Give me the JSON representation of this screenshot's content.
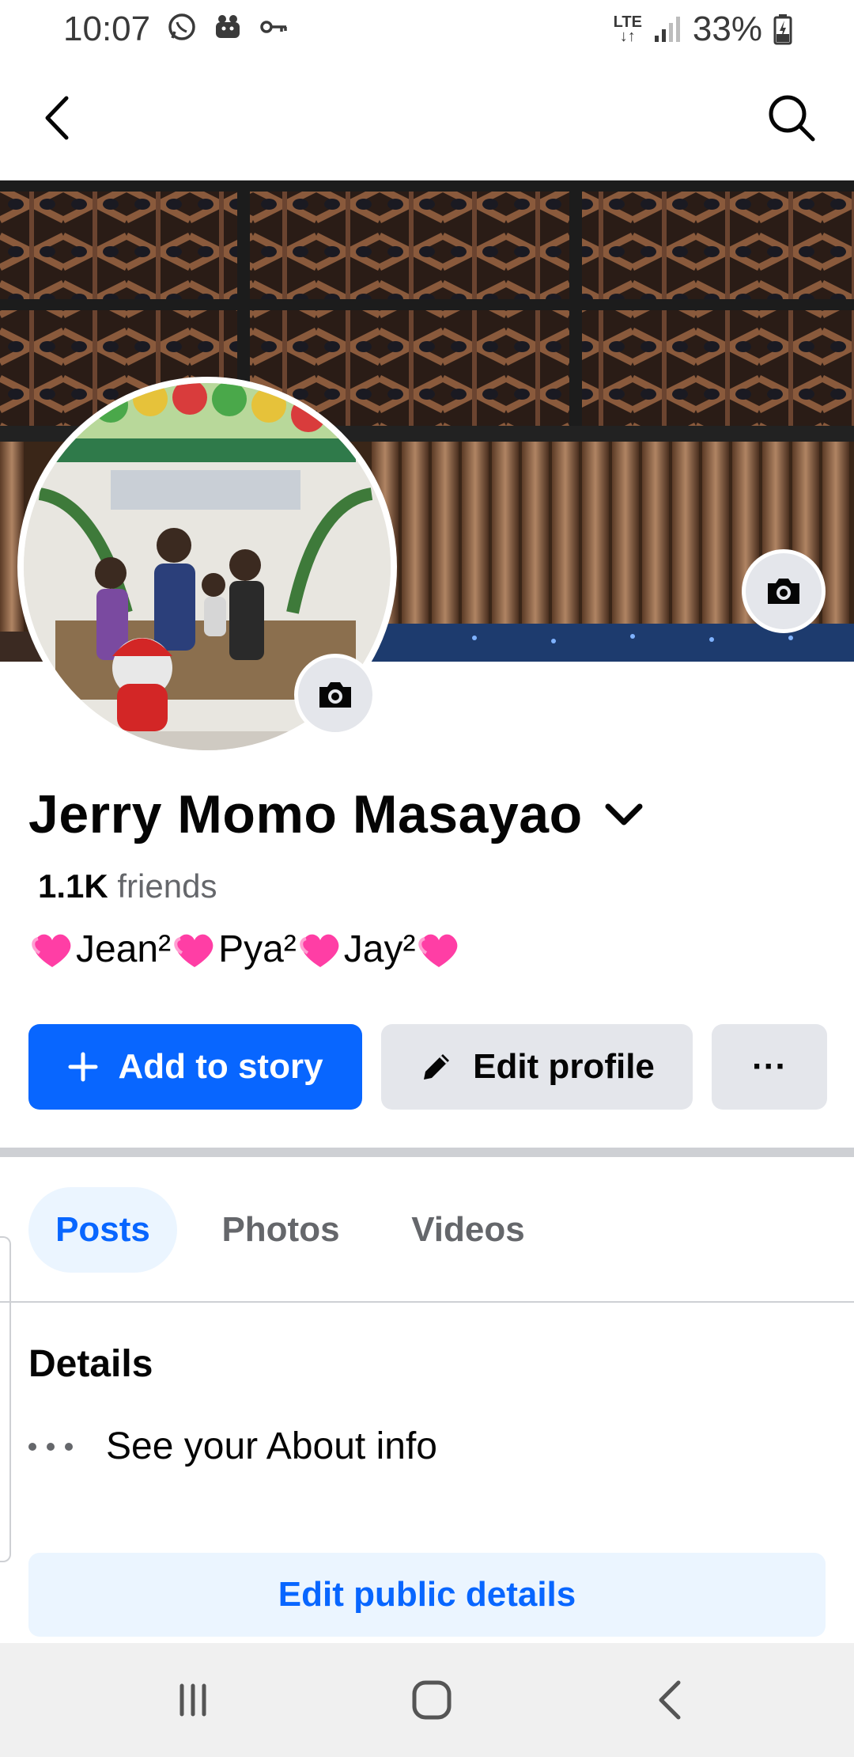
{
  "status_bar": {
    "time": "10:07",
    "network": "LTE",
    "battery": "33%",
    "left_icons": [
      "whatsapp-icon",
      "app-notification-icon",
      "vpn-key-icon"
    ]
  },
  "app_bar": {
    "back_icon": "back-arrow-icon",
    "search_icon": "search-icon"
  },
  "profile": {
    "name": "Jerry Momo Masayao",
    "friends_count": "1.1K",
    "friends_label": "friends",
    "bio_segments": [
      "Jean²",
      "Pya²",
      "Jay²"
    ]
  },
  "actions": {
    "add_story": "Add to story",
    "edit_profile": "Edit profile",
    "more": "···"
  },
  "tabs": [
    {
      "label": "Posts",
      "selected": true
    },
    {
      "label": "Photos",
      "selected": false
    },
    {
      "label": "Videos",
      "selected": false
    }
  ],
  "details": {
    "title": "Details",
    "about_text": "See your About info",
    "edit_public": "Edit public details"
  },
  "colors": {
    "accent": "#0866ff",
    "accent_light": "#ebf5ff",
    "button_gray": "#e4e6eb",
    "text_secondary": "#65676b"
  }
}
